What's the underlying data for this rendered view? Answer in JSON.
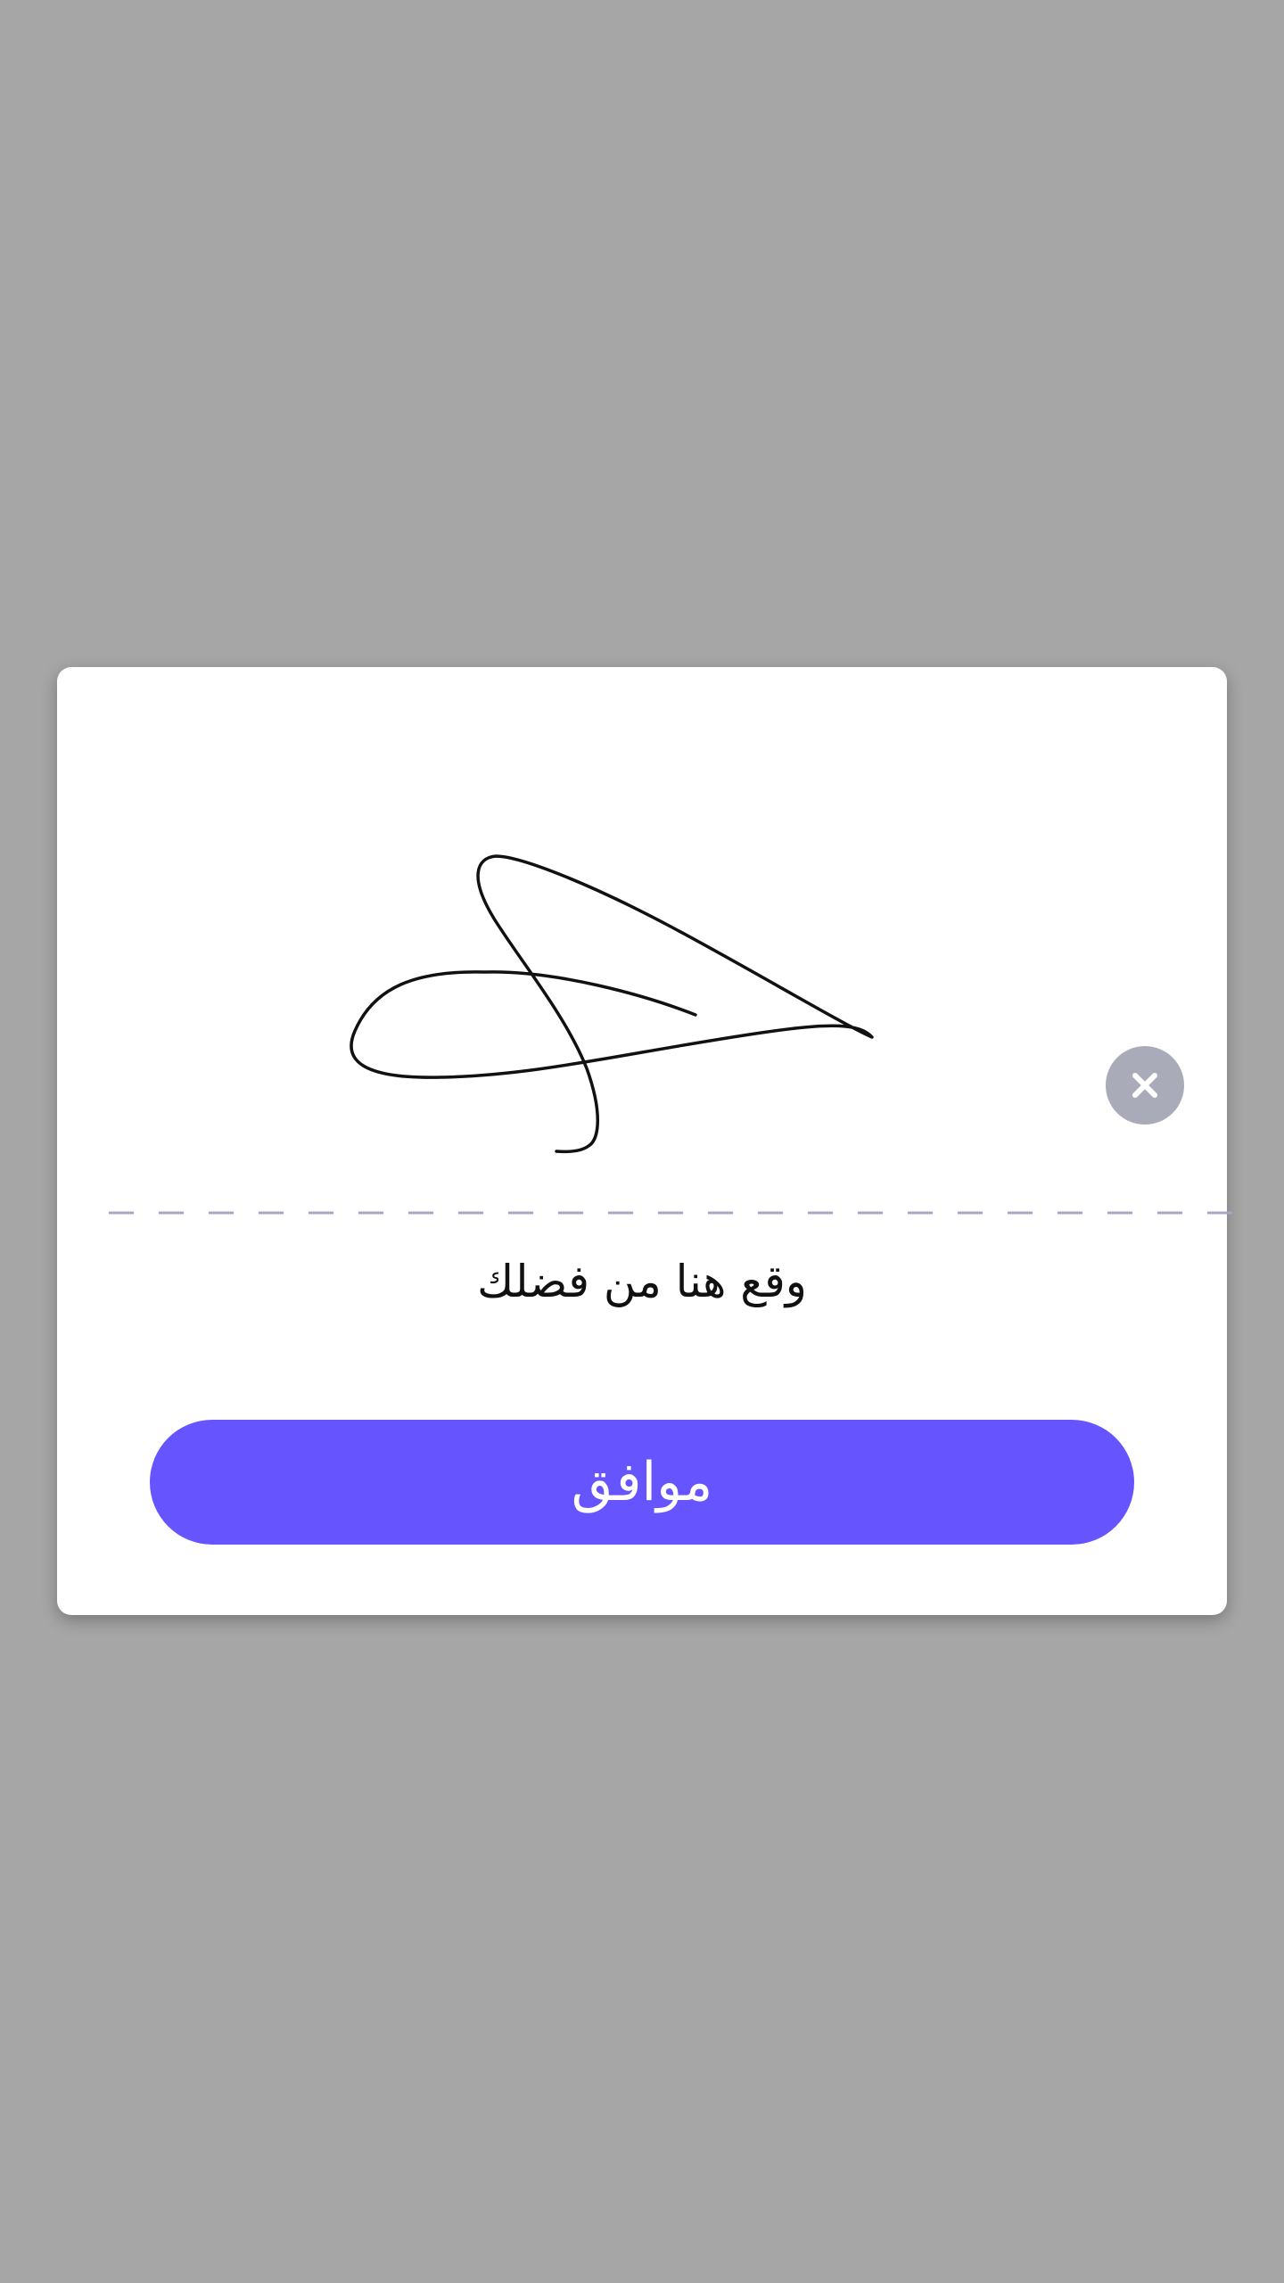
{
  "dialog": {
    "prompt_text": "وقع هنا من فضلك",
    "ok_label": "موافق",
    "clear_icon": "close-icon"
  },
  "colors": {
    "backdrop": "#a6a6a6",
    "dialog_bg": "#ffffff",
    "accent": "#6655ff",
    "clear_button_bg": "#a9abb8",
    "sign_line": "#a7a8c4",
    "ink": "#111111"
  }
}
